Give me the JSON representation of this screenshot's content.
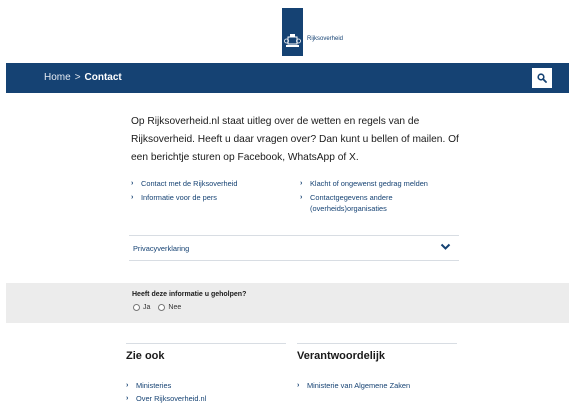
{
  "header": {
    "logo_text": "Rijksoverheid"
  },
  "nav": {
    "breadcrumb_home": "Home",
    "breadcrumb_separator": ">",
    "breadcrumb_current": "Contact",
    "search_icon": "search-icon"
  },
  "intro": {
    "text": "Op Rijksoverheid.nl staat uitleg over de wetten en regels van de Rijksoverheid. Heeft u daar vragen over? Dan kunt u bellen of mailen. Of een berichtje sturen op Facebook, WhatsApp of X."
  },
  "links_left": [
    {
      "label": "Contact met de Rijksoverheid"
    },
    {
      "label": "Informatie voor de pers"
    }
  ],
  "links_right": [
    {
      "label": "Klacht of ongewenst gedrag melden"
    },
    {
      "label": "Contactgegevens andere (overheids)organisaties"
    }
  ],
  "privacy": {
    "label": "Privacyverklaring",
    "icon": "chevron-down-icon"
  },
  "feedback": {
    "question": "Heeft deze informatie u geholpen?",
    "option_yes": "Ja",
    "option_no": "Nee"
  },
  "see_also": {
    "title": "Zie ook",
    "links": [
      {
        "label": "Ministeries"
      },
      {
        "label": "Over Rijksoverheid.nl"
      }
    ]
  },
  "responsible": {
    "title": "Verantwoordelijk",
    "links": [
      {
        "label": "Ministerie van Algemene Zaken"
      }
    ]
  },
  "colors": {
    "brand_blue": "#154273",
    "feedback_bg": "#ececec"
  }
}
